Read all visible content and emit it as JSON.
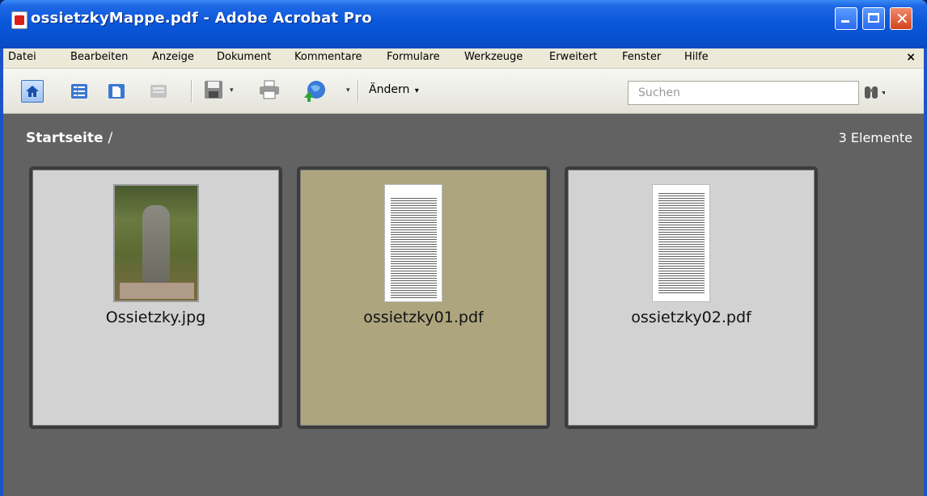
{
  "window": {
    "title": "ossietzkyMappe.pdf - Adobe Acrobat Pro",
    "controls": [
      "minimize-icon",
      "maximize-icon",
      "close-icon"
    ]
  },
  "menubar": {
    "items": [
      "Datei",
      "Bearbeiten",
      "Anzeige",
      "Dokument",
      "Kommentare",
      "Formulare",
      "Werkzeuge",
      "Erweitert",
      "Fenster",
      "Hilfe"
    ],
    "close_glyph": "×"
  },
  "toolbar": {
    "icons": [
      "home-icon",
      "list-view-icon",
      "page-view-icon",
      "cover-view-icon",
      "save-icon",
      "print-icon",
      "share-globe-icon"
    ],
    "edit_label": "Ändern",
    "dropdown_glyph": "▾",
    "search_placeholder": "Suchen"
  },
  "content": {
    "breadcrumb": "Startseite",
    "breadcrumb_sep": "/",
    "item_count": "3 Elemente",
    "items": [
      {
        "name": "Ossietzky.jpg",
        "type": "image",
        "selected": false
      },
      {
        "name": "ossietzky01.pdf",
        "type": "pdf",
        "selected": true
      },
      {
        "name": "ossietzky02.pdf",
        "type": "pdf",
        "selected": false
      }
    ]
  },
  "colors": {
    "content_bg": "#626262",
    "card_bg": "#d2d2d2",
    "card_selected_bg": "#ada57e",
    "titlebar_blue": "#0a58da"
  }
}
